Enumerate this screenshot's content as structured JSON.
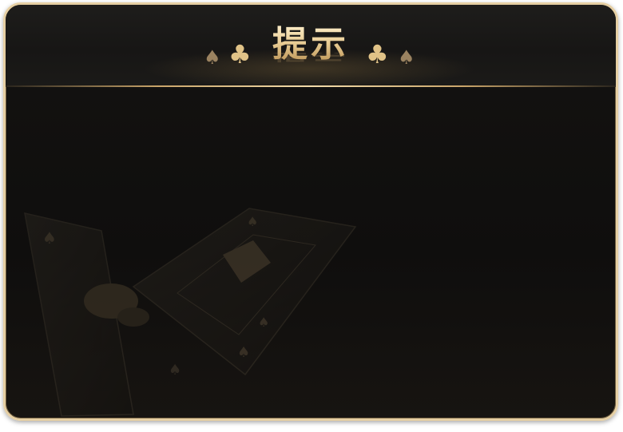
{
  "dialog": {
    "title": "提示",
    "title_suits": [
      "spade-icon",
      "club-icon",
      "club-icon",
      "spade-icon"
    ]
  },
  "colors": {
    "frame_border": "#e6cfa3",
    "panel_background": "#0f0e0d",
    "title_gold": "#e6c88f",
    "accent_line": "#f3dcaa"
  }
}
